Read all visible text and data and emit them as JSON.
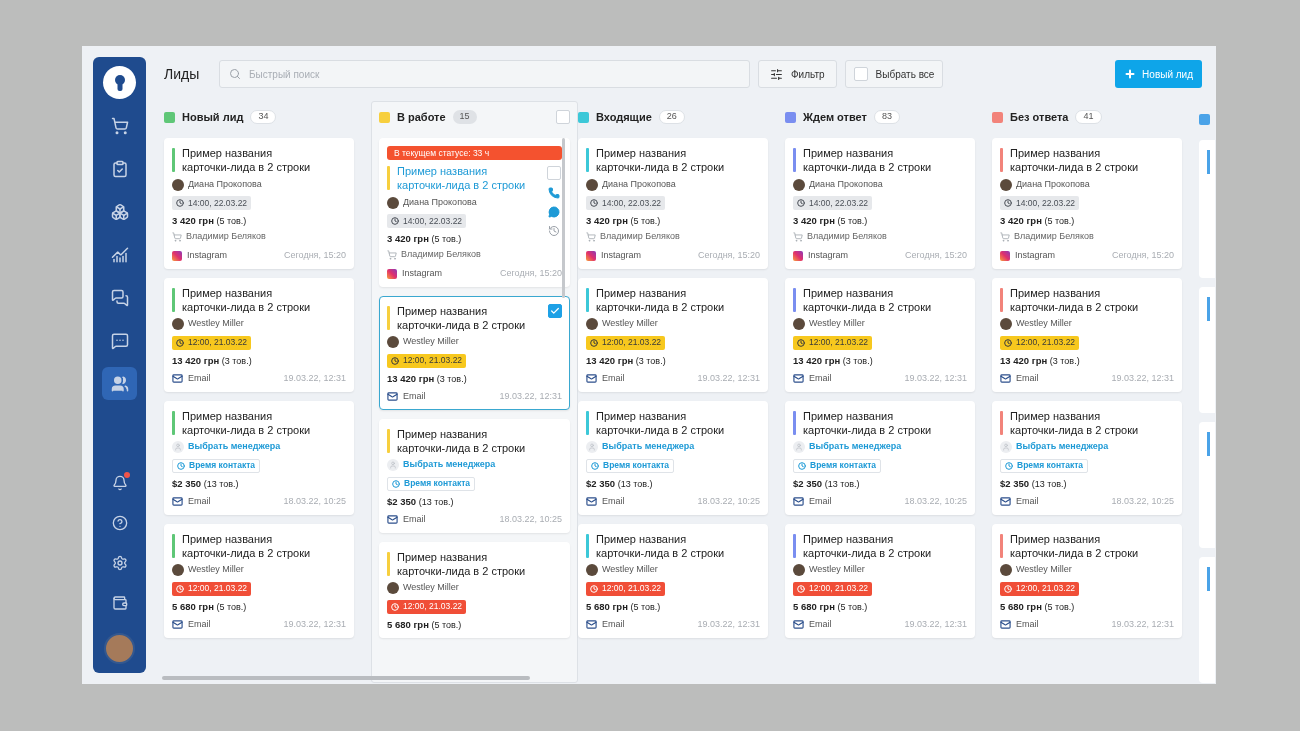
{
  "sidebar": {
    "items": [
      {
        "kind": "cart",
        "selected": false
      },
      {
        "kind": "clipboard",
        "selected": false
      },
      {
        "kind": "boxes",
        "selected": false
      },
      {
        "kind": "chart",
        "selected": false
      },
      {
        "kind": "chat",
        "selected": false
      },
      {
        "kind": "user-chat",
        "selected": false
      },
      {
        "kind": "users",
        "selected": true
      }
    ],
    "bottom": [
      {
        "kind": "bell",
        "badge": true
      },
      {
        "kind": "help",
        "badge": false
      },
      {
        "kind": "settings",
        "badge": false
      },
      {
        "kind": "wallet",
        "badge": false
      }
    ]
  },
  "header": {
    "title": "Лиды",
    "search": {
      "placeholder": "Быстрый поиск"
    },
    "filter_button": "Фильтр",
    "select_all": {
      "label": "Выбрать все",
      "checked": false
    },
    "new_button": "Новый лид"
  },
  "columns": [
    {
      "title": "Новый лид",
      "count": "34",
      "color": "#5fc777",
      "highlighted": false,
      "cards": [
        {
          "title": "Пример названия карточки-лида в 2 строки",
          "selected": false,
          "manager": {
            "kind": "person",
            "name": "Диана Прокопова"
          },
          "time": {
            "kind": "neutral",
            "text": "14:00, 22.03.22"
          },
          "amount": "3 420 грн",
          "items": "(5 тов.)",
          "buyer": "Владимир Беляков",
          "source": {
            "kind": "instagram",
            "label": "Instagram"
          },
          "date": "Сегодня, 15:20"
        },
        {
          "title": "Пример названия карточки-лида в 2 строки",
          "selected": false,
          "manager": {
            "kind": "person",
            "name": "Westley Miller"
          },
          "time": {
            "kind": "warning",
            "text": "12:00, 21.03.22"
          },
          "amount": "13 420 грн",
          "items": "(3 тов.)",
          "source": {
            "kind": "email",
            "label": "Email"
          },
          "date": "19.03.22, 12:31"
        },
        {
          "title": "Пример названия карточки-лида в 2 строки",
          "selected": false,
          "manager": {
            "kind": "unassigned",
            "name": "Выбрать менеджера"
          },
          "time": {
            "kind": "empty",
            "text": "Время контакта"
          },
          "amount": "$2 350",
          "items": "(13 тов.)",
          "source": {
            "kind": "email",
            "label": "Email"
          },
          "date": "18.03.22, 10:25"
        },
        {
          "title": "Пример названия карточки-лида в 2 строки",
          "selected": false,
          "manager": {
            "kind": "person",
            "name": "Westley Miller"
          },
          "time": {
            "kind": "overdue",
            "text": "12:00, 21.03.22"
          },
          "amount": "5 680 грн",
          "items": "(5 тов.)",
          "source": {
            "kind": "email",
            "label": "Email"
          },
          "date": "19.03.22, 12:31"
        }
      ]
    },
    {
      "title": "В работе",
      "count": "15",
      "color": "#f7cf3e",
      "highlighted": true,
      "checkbox": {
        "checked": false
      },
      "cards": [
        {
          "title": "Пример названия карточки-лида в 2 строки",
          "selected": false,
          "hovered": true,
          "banner": "В текущем статусе: 33 ч",
          "checkbox": {
            "checked": false
          },
          "manager": {
            "kind": "person",
            "name": "Диана Прокопова"
          },
          "time": {
            "kind": "neutral",
            "text": "14:00, 22.03.22"
          },
          "amount": "3 420 грн",
          "items": "(5 тов.)",
          "buyer": "Владимир Беляков",
          "source": {
            "kind": "instagram",
            "label": "Instagram"
          },
          "date": "Сегодня, 15:20"
        },
        {
          "title": "Пример названия карточки-лида в 2 строки",
          "selected": true,
          "checkbox": {
            "checked": true
          },
          "manager": {
            "kind": "person",
            "name": "Westley Miller"
          },
          "time": {
            "kind": "warning",
            "text": "12:00, 21.03.22"
          },
          "amount": "13 420 грн",
          "items": "(3 тов.)",
          "source": {
            "kind": "email",
            "label": "Email"
          },
          "date": "19.03.22, 12:31"
        },
        {
          "title": "Пример названия карточки-лида в 2 строки",
          "selected": false,
          "manager": {
            "kind": "unassigned",
            "name": "Выбрать менеджера"
          },
          "time": {
            "kind": "empty",
            "text": "Время контакта"
          },
          "amount": "$2 350",
          "items": "(13 тов.)",
          "source": {
            "kind": "email",
            "label": "Email"
          },
          "date": "18.03.22, 10:25"
        },
        {
          "title": "Пример названия карточки-лида в 2 строки",
          "selected": false,
          "manager": {
            "kind": "person",
            "name": "Westley Miller"
          },
          "time": {
            "kind": "overdue",
            "text": "12:00, 21.03.22"
          },
          "amount": "5 680 грн",
          "items": "(5 тов.)"
        }
      ]
    },
    {
      "title": "Входящие",
      "count": "26",
      "color": "#3cc8d8",
      "highlighted": false,
      "cards": [
        {
          "title": "Пример названия карточки-лида в 2 строки",
          "selected": false,
          "manager": {
            "kind": "person",
            "name": "Диана Прокопова"
          },
          "time": {
            "kind": "neutral",
            "text": "14:00, 22.03.22"
          },
          "amount": "3 420 грн",
          "items": "(5 тов.)",
          "buyer": "Владимир Беляков",
          "source": {
            "kind": "instagram",
            "label": "Instagram"
          },
          "date": "Сегодня, 15:20"
        },
        {
          "title": "Пример названия карточки-лида в 2 строки",
          "selected": false,
          "manager": {
            "kind": "person",
            "name": "Westley Miller"
          },
          "time": {
            "kind": "warning",
            "text": "12:00, 21.03.22"
          },
          "amount": "13 420 грн",
          "items": "(3 тов.)",
          "source": {
            "kind": "email",
            "label": "Email"
          },
          "date": "19.03.22, 12:31"
        },
        {
          "title": "Пример названия карточки-лида в 2 строки",
          "selected": false,
          "manager": {
            "kind": "unassigned",
            "name": "Выбрать менеджера"
          },
          "time": {
            "kind": "empty",
            "text": "Время контакта"
          },
          "amount": "$2 350",
          "items": "(13 тов.)",
          "source": {
            "kind": "email",
            "label": "Email"
          },
          "date": "18.03.22, 10:25"
        },
        {
          "title": "Пример названия карточки-лида в 2 строки",
          "selected": false,
          "manager": {
            "kind": "person",
            "name": "Westley Miller"
          },
          "time": {
            "kind": "overdue",
            "text": "12:00, 21.03.22"
          },
          "amount": "5 680 грн",
          "items": "(5 тов.)",
          "source": {
            "kind": "email",
            "label": "Email"
          },
          "date": "19.03.22, 12:31"
        }
      ]
    },
    {
      "title": "Ждем ответ",
      "count": "83",
      "color": "#7a8ef0",
      "highlighted": false,
      "cards": [
        {
          "title": "Пример названия карточки-лида в 2 строки",
          "selected": false,
          "manager": {
            "kind": "person",
            "name": "Диана Прокопова"
          },
          "time": {
            "kind": "neutral",
            "text": "14:00, 22.03.22"
          },
          "amount": "3 420 грн",
          "items": "(5 тов.)",
          "buyer": "Владимир Беляков",
          "source": {
            "kind": "instagram",
            "label": "Instagram"
          },
          "date": "Сегодня, 15:20"
        },
        {
          "title": "Пример названия карточки-лида в 2 строки",
          "selected": false,
          "manager": {
            "kind": "person",
            "name": "Westley Miller"
          },
          "time": {
            "kind": "warning",
            "text": "12:00, 21.03.22"
          },
          "amount": "13 420 грн",
          "items": "(3 тов.)",
          "source": {
            "kind": "email",
            "label": "Email"
          },
          "date": "19.03.22, 12:31"
        },
        {
          "title": "Пример названия карточки-лида в 2 строки",
          "selected": false,
          "manager": {
            "kind": "unassigned",
            "name": "Выбрать менеджера"
          },
          "time": {
            "kind": "empty",
            "text": "Время контакта"
          },
          "amount": "$2 350",
          "items": "(13 тов.)",
          "source": {
            "kind": "email",
            "label": "Email"
          },
          "date": "18.03.22, 10:25"
        },
        {
          "title": "Пример названия карточки-лида в 2 строки",
          "selected": false,
          "manager": {
            "kind": "person",
            "name": "Westley Miller"
          },
          "time": {
            "kind": "overdue",
            "text": "12:00, 21.03.22"
          },
          "amount": "5 680 грн",
          "items": "(5 тов.)",
          "source": {
            "kind": "email",
            "label": "Email"
          },
          "date": "19.03.22, 12:31"
        }
      ]
    },
    {
      "title": "Без ответа",
      "count": "41",
      "color": "#f2837a",
      "highlighted": false,
      "cards": [
        {
          "title": "Пример названия карточки-лида в 2 строки",
          "selected": false,
          "manager": {
            "kind": "person",
            "name": "Диана Прокопова"
          },
          "time": {
            "kind": "neutral",
            "text": "14:00, 22.03.22"
          },
          "amount": "3 420 грн",
          "items": "(5 тов.)",
          "buyer": "Владимир Беляков",
          "source": {
            "kind": "instagram",
            "label": "Instagram"
          },
          "date": "Сегодня, 15:20"
        },
        {
          "title": "Пример названия карточки-лида в 2 строки",
          "selected": false,
          "manager": {
            "kind": "person",
            "name": "Westley Miller"
          },
          "time": {
            "kind": "warning",
            "text": "12:00, 21.03.22"
          },
          "amount": "13 420 грн",
          "items": "(3 тов.)",
          "source": {
            "kind": "email",
            "label": "Email"
          },
          "date": "19.03.22, 12:31"
        },
        {
          "title": "Пример названия карточки-лида в 2 строки",
          "selected": false,
          "manager": {
            "kind": "unassigned",
            "name": "Выбрать менеджера"
          },
          "time": {
            "kind": "empty",
            "text": "Время контакта"
          },
          "amount": "$2 350",
          "items": "(13 тов.)",
          "source": {
            "kind": "email",
            "label": "Email"
          },
          "date": "18.03.22, 10:25"
        },
        {
          "title": "Пример названия карточки-лида в 2 строки",
          "selected": false,
          "manager": {
            "kind": "person",
            "name": "Westley Miller"
          },
          "time": {
            "kind": "overdue",
            "text": "12:00, 21.03.22"
          },
          "amount": "5 680 грн",
          "items": "(5 тов.)",
          "source": {
            "kind": "email",
            "label": "Email"
          },
          "date": "19.03.22, 12:31"
        }
      ]
    }
  ],
  "partial_column": {
    "color": "#4aa3e8"
  }
}
